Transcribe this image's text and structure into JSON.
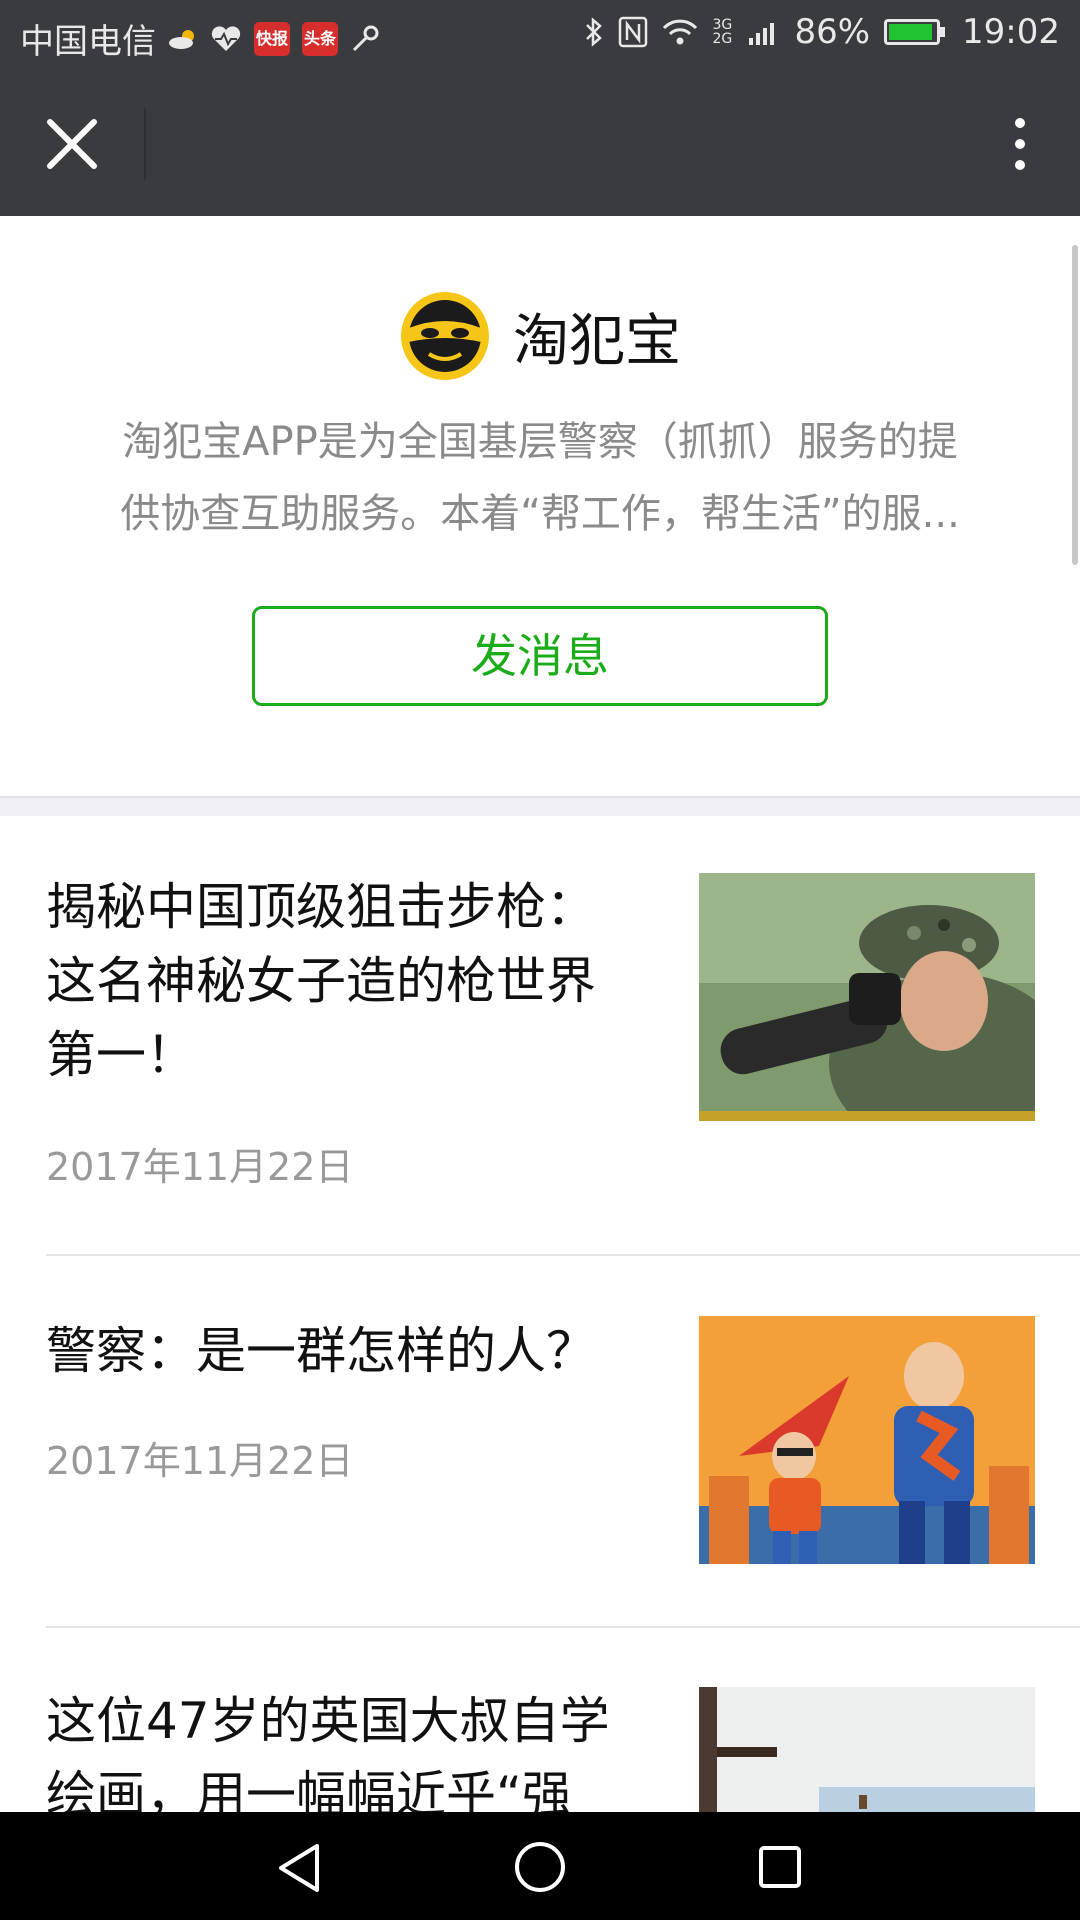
{
  "status_bar": {
    "carrier": "中国电信",
    "badge1": "快报",
    "badge2": "头条",
    "network": "3G 2G",
    "battery": "86%",
    "time": "19:02"
  },
  "account": {
    "name": "淘犯宝",
    "description_line1": "淘犯宝APP是为全国基层警察（抓抓）服务的提",
    "description_line2": "供协查互助服务。本着“帮工作，帮生活”的服...",
    "message_button": "发消息"
  },
  "articles": [
    {
      "title_lines": [
        "揭秘中国顶级狙击步枪：",
        "这名神秘女子造的枪世界",
        "第一！"
      ],
      "date": "2017年11月22日",
      "thumb": "soldier-with-spotting-scope"
    },
    {
      "title_lines": [
        "警察：是一群怎样的人？"
      ],
      "date": "2017年11月22日",
      "thumb": "superhero-cartoon"
    },
    {
      "title_lines": [
        "这位47岁的英国大叔自学",
        "绘画，用一幅幅近乎“强"
      ],
      "date": "",
      "thumb": "painting-wall"
    }
  ],
  "icons": {
    "close": "close-icon",
    "more": "more-vertical-icon",
    "back": "back-triangle-icon",
    "home": "home-circle-icon",
    "recent": "recent-square-icon"
  },
  "colors": {
    "accent_green": "#1aad19",
    "bar_dark": "#3a3b3f",
    "logo_yellow": "#f5c518"
  }
}
